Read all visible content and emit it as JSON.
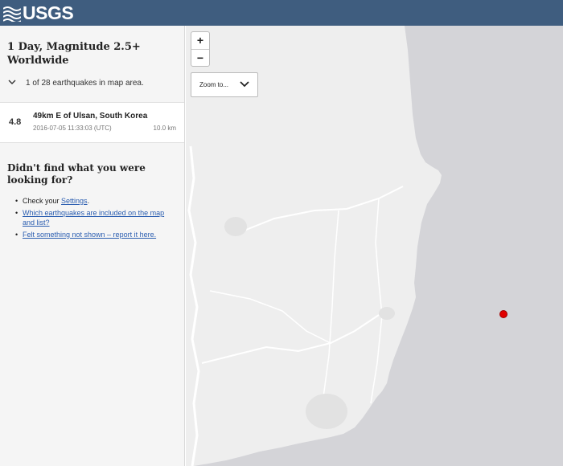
{
  "header": {
    "logo_text": "USGS"
  },
  "sidebar": {
    "feed_title_line1": "1 Day, Magnitude 2.5+",
    "feed_title_line2": "Worldwide",
    "count_text": "1 of 28 earthquakes in map area.",
    "earthquakes": [
      {
        "magnitude": "4.8",
        "place": "49km E of Ulsan, South Korea",
        "time": "2016-07-05 11:33:03 (UTC)",
        "depth": "10.0 km"
      }
    ],
    "help": {
      "title": "Didn't find what you were looking for?",
      "item1_prefix": "Check your ",
      "item1_link": "Settings",
      "item1_suffix": ".",
      "item2_link": "Which earthquakes are included on the map and list?",
      "item3_link": "Felt something not shown – report it here."
    }
  },
  "map": {
    "zoom_in": "+",
    "zoom_out": "−",
    "zoom_to_label": "Zoom to...",
    "marker_color": "#e00000"
  }
}
